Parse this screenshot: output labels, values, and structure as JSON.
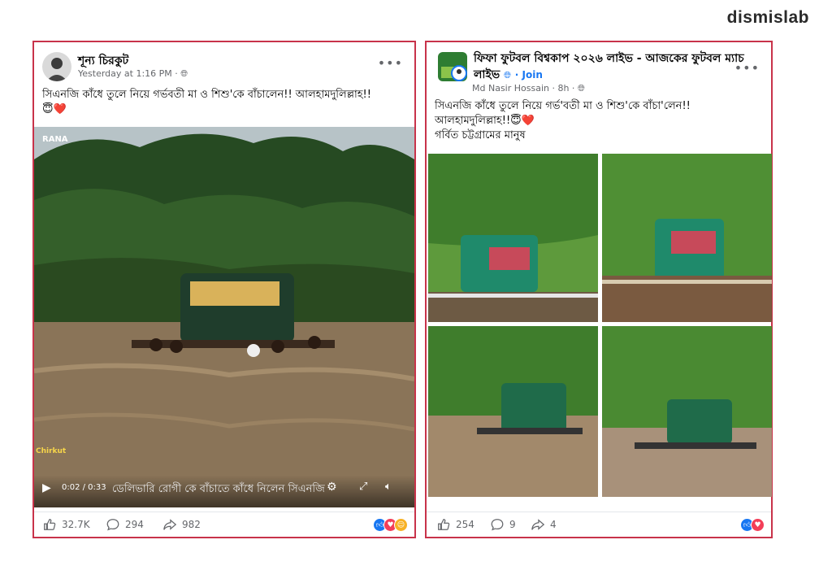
{
  "brand": "dismislab",
  "post1": {
    "author": "শূন্য চিরকুট",
    "time": "Yesterday at 1:16 PM · ",
    "caption": "সিএনজি কাঁধে তুলে নিয়ে গর্ভবতী মা ও শিশু'কে বাঁচালেন!! আলহামদুলিল্লাহ!!",
    "caption_emoji": "😇❤️",
    "watermark_top": "RANA",
    "watermark_side": "Chirkut",
    "video_time": "0:02 / 0:33",
    "video_subtitle": "ডেলিভারি রোগী কে বাঁচাতে কাঁধে নিলেন সিএনজি",
    "likes": "32.7K",
    "comments": "294",
    "shares": "982"
  },
  "post2": {
    "author": "ফিফা ফুটবল বিশ্বকাপ ২০২৬ লাইভ - আজকের ফুটবল ম্যাচ লাইভ",
    "join": "· Join",
    "member": "Md Nasir Hossain · 8h · ",
    "caption_line1": "সিএনজি কাঁধে তুলে নিয়ে গর্ভ'বতী মা ও শিশু'কে বাঁচা'লেন!!",
    "caption_line2": "আলহামদুলিল্লাহ!!😇❤️",
    "caption_line3": "গর্বিত চট্টগ্রামের মানুষ",
    "likes": "254",
    "comments": "9",
    "shares": "4"
  },
  "colors": {
    "frame": "#c8334a",
    "like_blue": "#1877f2",
    "love_red": "#f33e58"
  }
}
